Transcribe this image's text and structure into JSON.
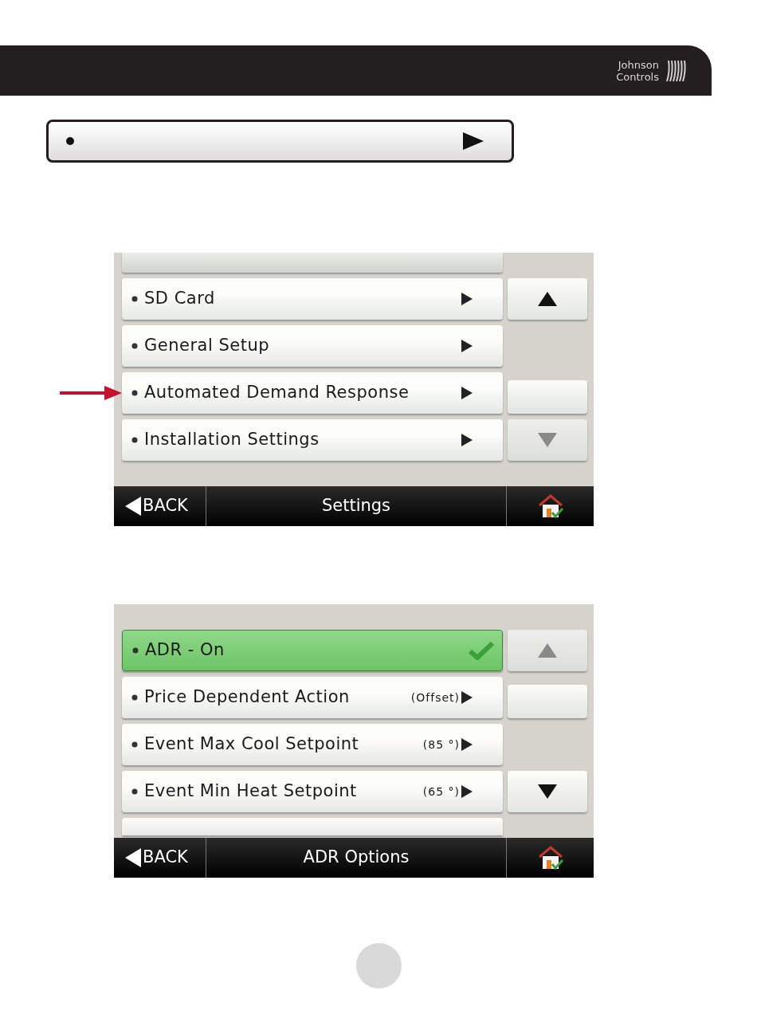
{
  "header": {
    "logo_lines": [
      "Johnson",
      "Controls"
    ]
  },
  "screens": [
    {
      "title": "Settings",
      "back": "BACK",
      "items": [
        {
          "kind": "partial"
        },
        {
          "kind": "option",
          "label": "SD Card",
          "selected": false,
          "arrow": false
        },
        {
          "kind": "option",
          "label": "General Setup",
          "selected": false,
          "arrow": false
        },
        {
          "kind": "option",
          "label": "Automated Demand Response",
          "selected": false,
          "arrow": true
        },
        {
          "kind": "option",
          "label": "Installation Settings",
          "selected": false,
          "arrow": false
        }
      ],
      "side": [
        {
          "kind": "empty"
        },
        {
          "kind": "up",
          "disabled": false
        },
        {
          "kind": "empty"
        },
        {
          "kind": "blank"
        },
        {
          "kind": "down",
          "disabled": true
        }
      ]
    },
    {
      "title": "ADR Options",
      "back": "BACK",
      "items": [
        {
          "kind": "option",
          "label": "ADR - On",
          "selected": true,
          "arrow": false
        },
        {
          "kind": "option",
          "label": "Price Dependent Action",
          "value": "(Offset)",
          "selected": false,
          "arrow": false
        },
        {
          "kind": "option",
          "label": "Event Max Cool Setpoint",
          "value": "(85 °)",
          "selected": false,
          "arrow": false
        },
        {
          "kind": "option",
          "label": "Event Min Heat Setpoint",
          "value": "(65 °)",
          "selected": false,
          "arrow": false
        },
        {
          "kind": "partial"
        }
      ],
      "side": [
        {
          "kind": "up",
          "disabled": true
        },
        {
          "kind": "blank"
        },
        {
          "kind": "empty"
        },
        {
          "kind": "down",
          "disabled": false
        },
        {
          "kind": "empty"
        }
      ]
    }
  ]
}
